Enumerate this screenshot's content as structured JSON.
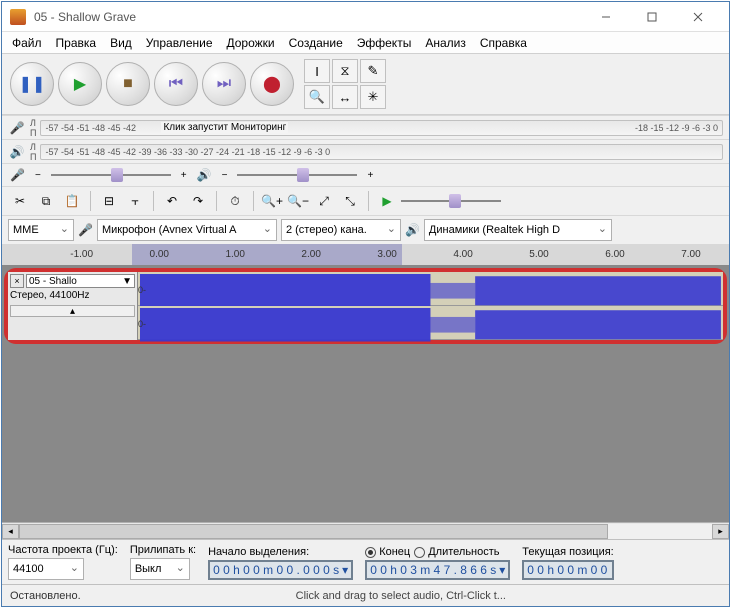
{
  "title": "05 - Shallow Grave",
  "menu": {
    "file": "Файл",
    "edit": "Правка",
    "view": "Вид",
    "control": "Управление",
    "tracks": "Дорожки",
    "generate": "Создание",
    "effects": "Эффекты",
    "analyze": "Анализ",
    "help": "Справка"
  },
  "meter": {
    "mic_ticks": "-57 -54 -51 -48 -45 -42",
    "mic_msg": "Клик запустит Мониторинг",
    "mic_ticks2": "-18 -15 -12 -9 -6 -3 0",
    "spk_ticks": "-57 -54 -51 -48 -45 -42 -39 -36 -33 -30 -27 -24 -21 -18 -15 -12 -9 -6 -3 0"
  },
  "device": {
    "host": "MME",
    "rec": "Микрофон (Avnex Virtual A",
    "chan": "2 (стерео) кана.",
    "play": "Динамики (Realtek High D"
  },
  "ruler_labels": [
    "-1.00",
    "0.00",
    "1.00",
    "2.00",
    "3.00",
    "4.00",
    "5.00",
    "6.00",
    "7.00"
  ],
  "track": {
    "name": "05 - Shallo",
    "info": "Стерео, 44100Hz",
    "zero": "0-"
  },
  "bottom": {
    "rate_label": "Частота проекта (Гц):",
    "rate_value": "44100",
    "snap_label": "Прилипать к:",
    "snap_value": "Выкл",
    "sel_start_label": "Начало выделения:",
    "sel_start": "0 0 h 0 0 m 0 0 . 0 0 0 s",
    "end_label": "Конец",
    "len_label": "Длительность",
    "sel_end": "0 0 h 0 3 m 4 7 . 8 6 6 s",
    "pos_label": "Текущая позиция:",
    "pos": "0 0 h 0 0 m 0 0"
  },
  "status": {
    "left": "Остановлено.",
    "hint": "Click and drag to select audio, Ctrl-Click t..."
  }
}
